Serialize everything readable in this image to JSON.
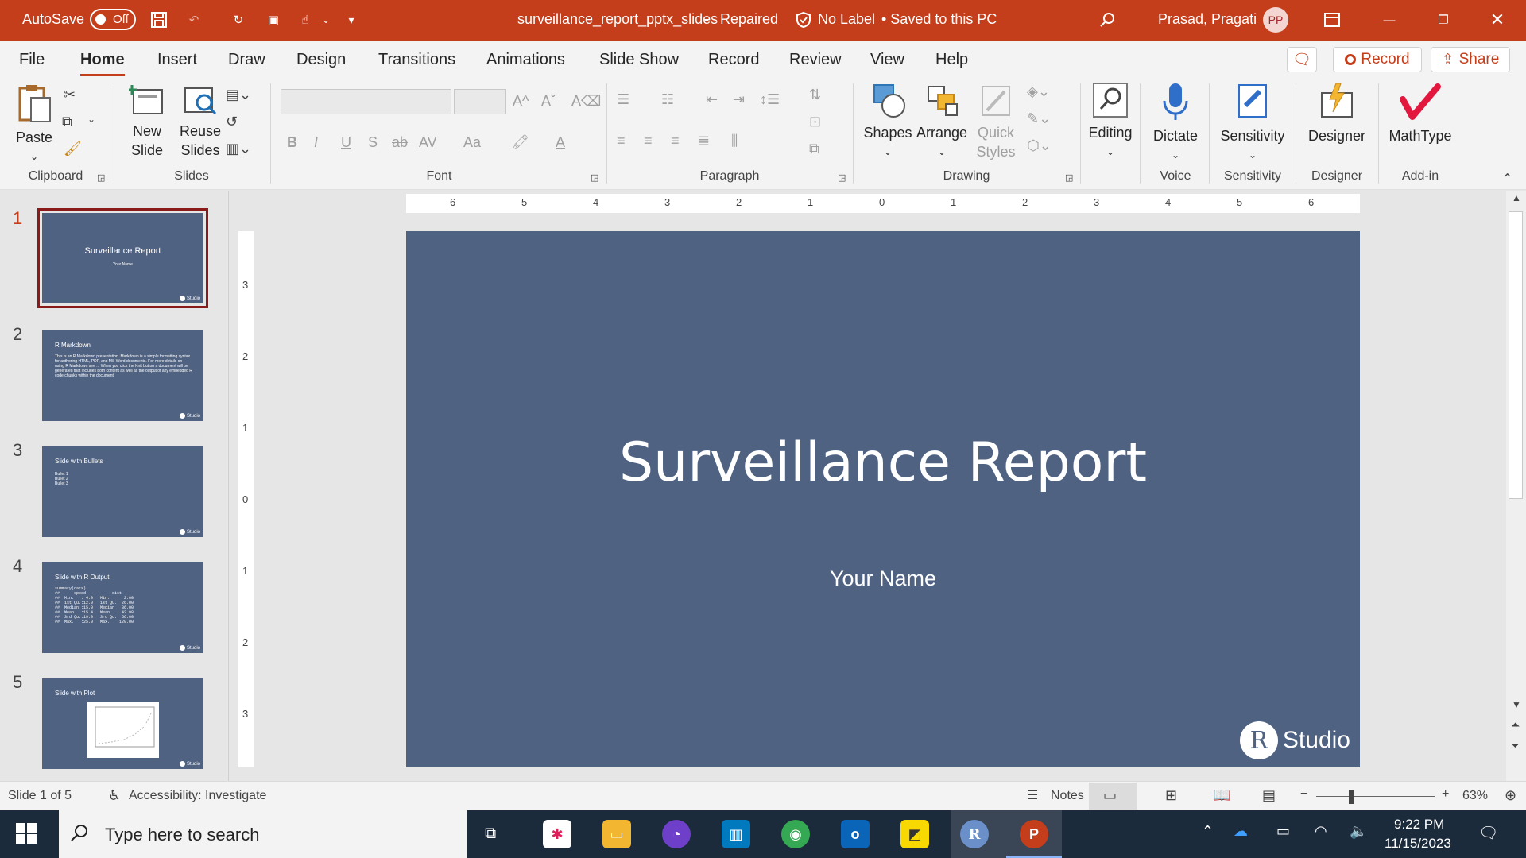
{
  "titlebar": {
    "autosave_label": "AutoSave",
    "autosave_state": "Off",
    "doc_title": "surveillance_report_pptx_slides",
    "doc_status": "Repaired",
    "label_status": "No Label",
    "saved_status": "• Saved to this PC",
    "user_name": "Prasad, Pragati",
    "user_initials": "PP",
    "accent": "#c43e1c"
  },
  "menu": {
    "tabs": [
      "File",
      "Home",
      "Insert",
      "Draw",
      "Design",
      "Transitions",
      "Animations",
      "Slide Show",
      "Record",
      "Review",
      "View",
      "Help"
    ],
    "active": "Home",
    "record_label": "Record",
    "share_label": "Share"
  },
  "ribbon": {
    "clipboard": {
      "paste": "Paste",
      "group": "Clipboard"
    },
    "slides": {
      "new_slide_1": "New",
      "new_slide_2": "Slide",
      "reuse_1": "Reuse",
      "reuse_2": "Slides",
      "group": "Slides"
    },
    "font": {
      "bold": "B",
      "italic": "I",
      "underline": "U",
      "shadow": "S",
      "strike": "ab",
      "spacing": "AV",
      "case": "Aa",
      "group": "Font"
    },
    "paragraph": {
      "group": "Paragraph"
    },
    "drawing": {
      "shapes": "Shapes",
      "arrange": "Arrange",
      "quick_1": "Quick",
      "quick_2": "Styles",
      "group": "Drawing"
    },
    "editing": {
      "label": "Editing"
    },
    "voice": {
      "dictate": "Dictate",
      "group": "Voice"
    },
    "sensitivity": {
      "label": "Sensitivity",
      "group": "Sensitivity"
    },
    "designer": {
      "label": "Designer",
      "group": "Designer"
    },
    "addin": {
      "label": "MathType",
      "group": "Add-in"
    }
  },
  "thumbnails": [
    {
      "num": "1",
      "title": "Surveillance Report",
      "subtitle": "Your Name"
    },
    {
      "num": "2",
      "title": "R Markdown",
      "body": "This is an R Markdown presentation. Markdown is a simple formatting syntax for authoring HTML, PDF, and MS Word documents. For more details on using R Markdown see ... When you click the Knit button a document will be generated that includes both content as well as the output of any embedded R code chunks within the document."
    },
    {
      "num": "3",
      "title": "Slide with Bullets",
      "bullets": [
        "Bullet 1",
        "Bullet 2",
        "Bullet 3"
      ]
    },
    {
      "num": "4",
      "title": "Slide with R Output",
      "code": "summary(cars)\n##      speed           dist\n##  Min.   : 4.0   Min.   :  2.00\n##  1st Qu.:12.0   1st Qu.: 26.00\n##  Median :15.0   Median : 36.00\n##  Mean   :15.4   Mean   : 42.98\n##  3rd Qu.:19.0   3rd Qu.: 56.00\n##  Max.   :25.0   Max.   :120.00"
    },
    {
      "num": "5",
      "title": "Slide with Plot"
    }
  ],
  "thumb_logo": "Studio",
  "slide": {
    "title": "Surveillance Report",
    "subtitle": "Your Name",
    "logo_r": "R",
    "logo_text": "Studio",
    "bg_color": "#4f6282"
  },
  "ruler": {
    "h": [
      "6",
      "5",
      "4",
      "3",
      "2",
      "1",
      "0",
      "1",
      "2",
      "3",
      "4",
      "5",
      "6"
    ],
    "v": [
      "3",
      "2",
      "1",
      "0",
      "1",
      "2",
      "3"
    ]
  },
  "status": {
    "slide_info": "Slide 1 of 5",
    "accessibility": "Accessibility: Investigate",
    "notes": "Notes",
    "zoom": "63%",
    "zoom_minus": "−",
    "zoom_plus": "+"
  },
  "taskbar": {
    "search_placeholder": "Type here to search",
    "time": "9:22 PM",
    "date": "11/15/2023",
    "apps": [
      {
        "name": "slack",
        "label": "",
        "color": "#ffffff"
      },
      {
        "name": "file-explorer",
        "label": "",
        "color": "#f2b630"
      },
      {
        "name": "github",
        "label": "",
        "color": "#6e40c9"
      },
      {
        "name": "trello",
        "label": "",
        "color": "#0079bf"
      },
      {
        "name": "chrome",
        "label": "",
        "color": "#34a853"
      },
      {
        "name": "outlook",
        "label": "o",
        "color": "#0a64b8"
      },
      {
        "name": "sticky-notes",
        "label": "",
        "color": "#f7d800"
      },
      {
        "name": "r",
        "label": "R",
        "color": "#6b8fc9"
      },
      {
        "name": "powerpoint",
        "label": "P",
        "color": "#c43e1c"
      }
    ]
  }
}
